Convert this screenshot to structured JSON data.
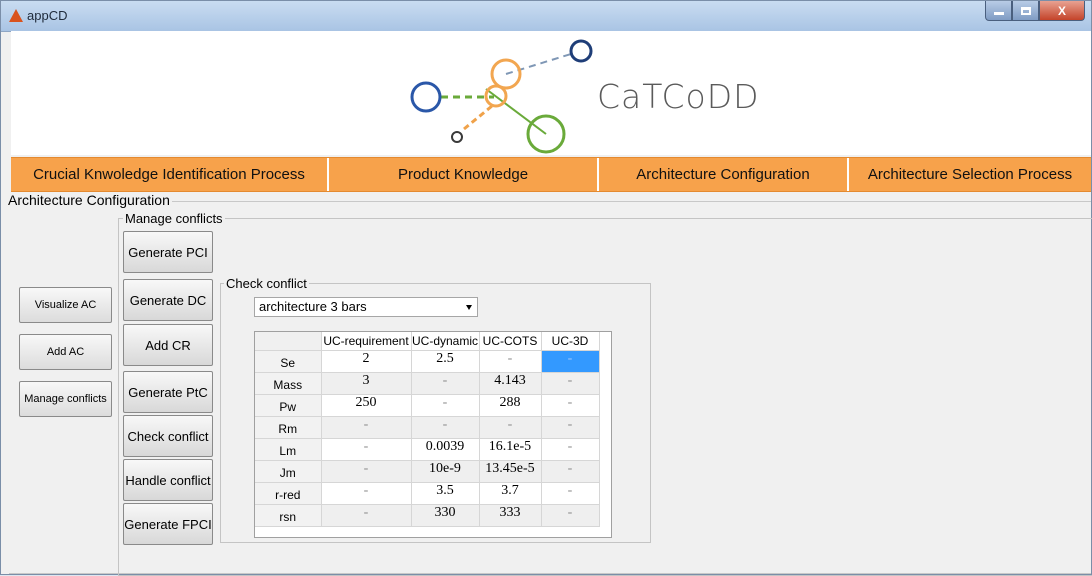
{
  "window": {
    "title": "appCD"
  },
  "banner": {
    "logo_text": "CaTCoDD"
  },
  "nav": [
    "Crucial Knwoledge Identification Process",
    "Product Knowledge",
    "Architecture Configuration",
    "Architecture Selection Process"
  ],
  "section_title": "Architecture Configuration",
  "side_buttons": [
    "Visualize AC",
    "Add AC",
    "Manage conflicts"
  ],
  "manage_conflicts": {
    "label": "Manage conflicts",
    "buttons": [
      "Generate PCI",
      "Generate DC",
      "Add CR",
      "Generate PtC",
      "Check conflict",
      "Handle conflict",
      "Generate FPCI"
    ]
  },
  "check_conflict": {
    "label": "Check conflict",
    "selected_architecture": "architecture 3 bars",
    "columns": [
      "UC-requirement",
      "UC-dynamic",
      "UC-COTS",
      "UC-3D"
    ],
    "rows": [
      {
        "name": "Se",
        "values": [
          "2",
          "2.5",
          "-",
          "-"
        ]
      },
      {
        "name": "Mass",
        "values": [
          "3",
          "-",
          "4.143",
          "-"
        ]
      },
      {
        "name": "Pw",
        "values": [
          "250",
          "-",
          "288",
          "-"
        ]
      },
      {
        "name": "Rm",
        "values": [
          "-",
          "-",
          "-",
          "-"
        ]
      },
      {
        "name": "Lm",
        "values": [
          "-",
          "0.0039",
          "16.1e-5",
          "-"
        ]
      },
      {
        "name": "Jm",
        "values": [
          "-",
          "10e-9",
          "13.45e-5",
          "-"
        ]
      },
      {
        "name": "r-red",
        "values": [
          "-",
          "3.5",
          "3.7",
          "-"
        ]
      },
      {
        "name": "rsn",
        "values": [
          "-",
          "330",
          "333",
          "-"
        ]
      }
    ]
  },
  "colors": {
    "nav_bg": "#f7a24b",
    "selected_cell": "#3399ff"
  }
}
